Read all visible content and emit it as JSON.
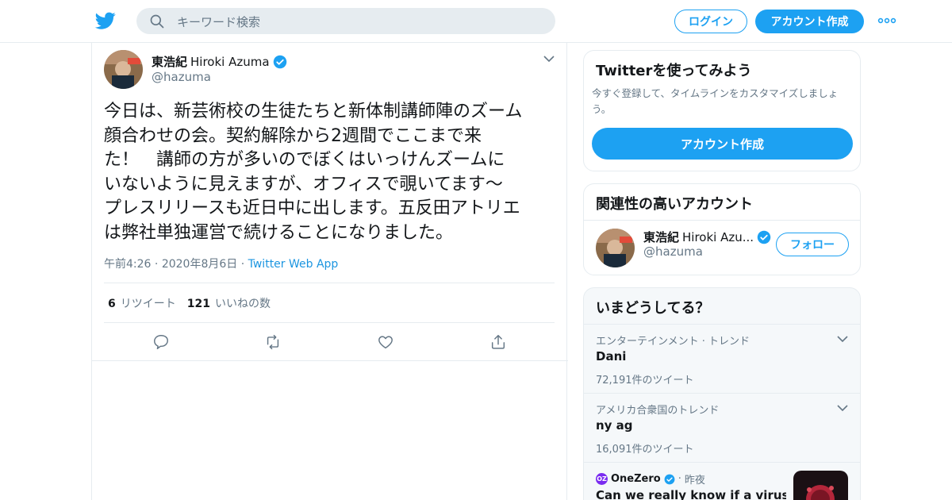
{
  "header": {
    "logo_icon": "twitter-bird-icon",
    "search_placeholder": "キーワード検索",
    "login_label": "ログイン",
    "signup_label": "アカウント作成",
    "more_icon": "more-dots-icon",
    "brand_color": "#1da1f2"
  },
  "tweet": {
    "author_name_jp": "東浩紀",
    "author_name_en": "Hiroki Azuma",
    "author_handle": "@hazuma",
    "verified": true,
    "text": "今日は、新芸術校の生徒たちと新体制講師陣のズーム\n顔合わせの会。契約解除から2週間でここまで来\nた！　講師の方が多いのでぼくはいっけんズームに\nいないように見えますが、オフィスで覗いてます〜\nプレスリリースも近日中に出します。五反田アトリエ\nは弊社単独運営で続けることになりました。",
    "time": "午前4:26",
    "date": "2020年8月6日",
    "via": "Twitter Web App",
    "retweets_count": "6",
    "retweets_label": "リツイート",
    "likes_count": "121",
    "likes_label": "いいねの数",
    "actions": [
      "reply-icon",
      "retweet-icon",
      "like-icon",
      "share-icon"
    ]
  },
  "sidebar": {
    "signup_card": {
      "title": "Twitterを使ってみよう",
      "description": "今すぐ登録して、タイムラインをカスタマイズしましょう。",
      "button_label": "アカウント作成"
    },
    "related_card": {
      "title": "関連性の高いアカウント",
      "account_name_jp": "東浩紀",
      "account_name_en": "Hiroki Azu...",
      "account_handle": "@hazuma",
      "follow_label": "フォロー"
    },
    "trends_card": {
      "title": "いまどうしてる？",
      "trends": [
        {
          "context": "エンターテインメント · トレンド",
          "name": "Dani",
          "count": "72,191件のツイート"
        },
        {
          "context": "アメリカ合衆国のトレンド",
          "name": "ny ag",
          "count": "16,091件のツイート"
        }
      ],
      "news": {
        "source_logo": "OZ",
        "source": "OneZero",
        "time": "昨夜",
        "headline": "Can we really know if a virus was"
      }
    }
  }
}
